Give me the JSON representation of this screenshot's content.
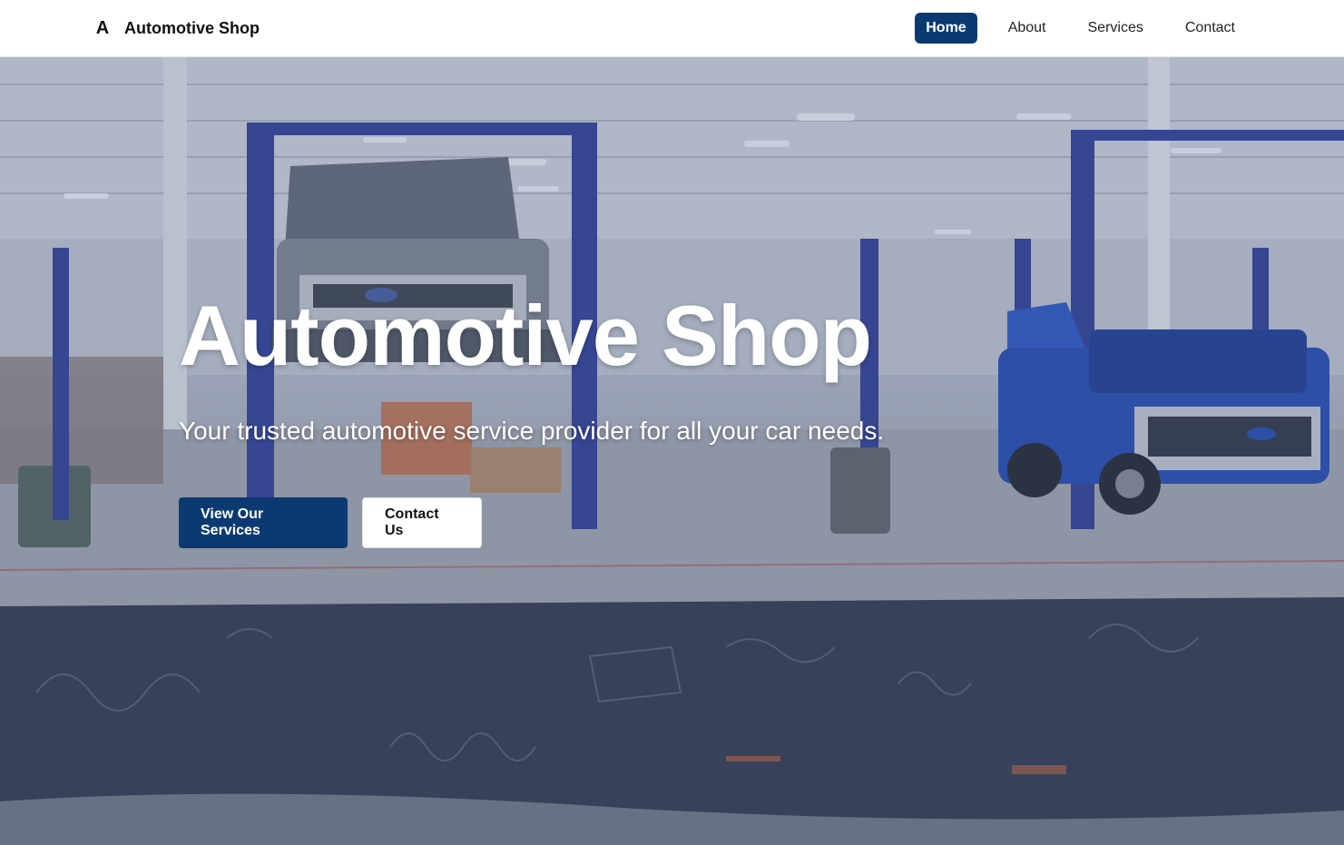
{
  "header": {
    "brand_mark": "A",
    "brand_name": "Automotive Shop",
    "nav": [
      {
        "label": "Home",
        "active": true
      },
      {
        "label": "About",
        "active": false
      },
      {
        "label": "Services",
        "active": false
      },
      {
        "label": "Contact",
        "active": false
      }
    ]
  },
  "hero": {
    "title": "Automotive Shop",
    "subtitle": "Your trusted automotive service provider for all your car needs.",
    "primary_button": "View Our Services",
    "secondary_button": "Contact Us",
    "background_image": "auto-shop-garage-photo"
  },
  "colors": {
    "brand_navy": "#0b3a73",
    "white": "#ffffff"
  }
}
